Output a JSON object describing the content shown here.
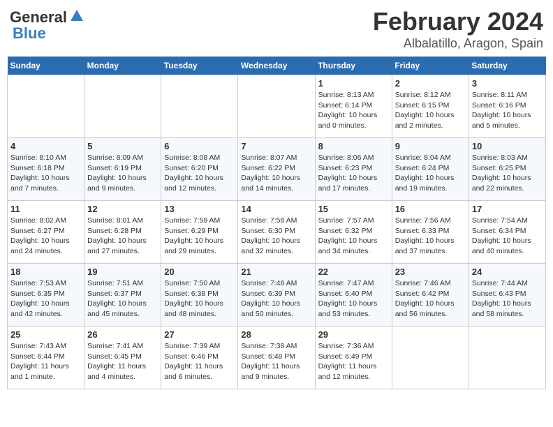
{
  "logo": {
    "text_general": "General",
    "text_blue": "Blue"
  },
  "header": {
    "title": "February 2024",
    "subtitle": "Albalatillo, Aragon, Spain"
  },
  "weekdays": [
    "Sunday",
    "Monday",
    "Tuesday",
    "Wednesday",
    "Thursday",
    "Friday",
    "Saturday"
  ],
  "weeks": [
    [
      {
        "day": "",
        "info": ""
      },
      {
        "day": "",
        "info": ""
      },
      {
        "day": "",
        "info": ""
      },
      {
        "day": "",
        "info": ""
      },
      {
        "day": "1",
        "info": "Sunrise: 8:13 AM\nSunset: 6:14 PM\nDaylight: 10 hours\nand 0 minutes."
      },
      {
        "day": "2",
        "info": "Sunrise: 8:12 AM\nSunset: 6:15 PM\nDaylight: 10 hours\nand 2 minutes."
      },
      {
        "day": "3",
        "info": "Sunrise: 8:11 AM\nSunset: 6:16 PM\nDaylight: 10 hours\nand 5 minutes."
      }
    ],
    [
      {
        "day": "4",
        "info": "Sunrise: 8:10 AM\nSunset: 6:18 PM\nDaylight: 10 hours\nand 7 minutes."
      },
      {
        "day": "5",
        "info": "Sunrise: 8:09 AM\nSunset: 6:19 PM\nDaylight: 10 hours\nand 9 minutes."
      },
      {
        "day": "6",
        "info": "Sunrise: 8:08 AM\nSunset: 6:20 PM\nDaylight: 10 hours\nand 12 minutes."
      },
      {
        "day": "7",
        "info": "Sunrise: 8:07 AM\nSunset: 6:22 PM\nDaylight: 10 hours\nand 14 minutes."
      },
      {
        "day": "8",
        "info": "Sunrise: 8:06 AM\nSunset: 6:23 PM\nDaylight: 10 hours\nand 17 minutes."
      },
      {
        "day": "9",
        "info": "Sunrise: 8:04 AM\nSunset: 6:24 PM\nDaylight: 10 hours\nand 19 minutes."
      },
      {
        "day": "10",
        "info": "Sunrise: 8:03 AM\nSunset: 6:25 PM\nDaylight: 10 hours\nand 22 minutes."
      }
    ],
    [
      {
        "day": "11",
        "info": "Sunrise: 8:02 AM\nSunset: 6:27 PM\nDaylight: 10 hours\nand 24 minutes."
      },
      {
        "day": "12",
        "info": "Sunrise: 8:01 AM\nSunset: 6:28 PM\nDaylight: 10 hours\nand 27 minutes."
      },
      {
        "day": "13",
        "info": "Sunrise: 7:59 AM\nSunset: 6:29 PM\nDaylight: 10 hours\nand 29 minutes."
      },
      {
        "day": "14",
        "info": "Sunrise: 7:58 AM\nSunset: 6:30 PM\nDaylight: 10 hours\nand 32 minutes."
      },
      {
        "day": "15",
        "info": "Sunrise: 7:57 AM\nSunset: 6:32 PM\nDaylight: 10 hours\nand 34 minutes."
      },
      {
        "day": "16",
        "info": "Sunrise: 7:56 AM\nSunset: 6:33 PM\nDaylight: 10 hours\nand 37 minutes."
      },
      {
        "day": "17",
        "info": "Sunrise: 7:54 AM\nSunset: 6:34 PM\nDaylight: 10 hours\nand 40 minutes."
      }
    ],
    [
      {
        "day": "18",
        "info": "Sunrise: 7:53 AM\nSunset: 6:35 PM\nDaylight: 10 hours\nand 42 minutes."
      },
      {
        "day": "19",
        "info": "Sunrise: 7:51 AM\nSunset: 6:37 PM\nDaylight: 10 hours\nand 45 minutes."
      },
      {
        "day": "20",
        "info": "Sunrise: 7:50 AM\nSunset: 6:38 PM\nDaylight: 10 hours\nand 48 minutes."
      },
      {
        "day": "21",
        "info": "Sunrise: 7:48 AM\nSunset: 6:39 PM\nDaylight: 10 hours\nand 50 minutes."
      },
      {
        "day": "22",
        "info": "Sunrise: 7:47 AM\nSunset: 6:40 PM\nDaylight: 10 hours\nand 53 minutes."
      },
      {
        "day": "23",
        "info": "Sunrise: 7:46 AM\nSunset: 6:42 PM\nDaylight: 10 hours\nand 56 minutes."
      },
      {
        "day": "24",
        "info": "Sunrise: 7:44 AM\nSunset: 6:43 PM\nDaylight: 10 hours\nand 58 minutes."
      }
    ],
    [
      {
        "day": "25",
        "info": "Sunrise: 7:43 AM\nSunset: 6:44 PM\nDaylight: 11 hours\nand 1 minute."
      },
      {
        "day": "26",
        "info": "Sunrise: 7:41 AM\nSunset: 6:45 PM\nDaylight: 11 hours\nand 4 minutes."
      },
      {
        "day": "27",
        "info": "Sunrise: 7:39 AM\nSunset: 6:46 PM\nDaylight: 11 hours\nand 6 minutes."
      },
      {
        "day": "28",
        "info": "Sunrise: 7:38 AM\nSunset: 6:48 PM\nDaylight: 11 hours\nand 9 minutes."
      },
      {
        "day": "29",
        "info": "Sunrise: 7:36 AM\nSunset: 6:49 PM\nDaylight: 11 hours\nand 12 minutes."
      },
      {
        "day": "",
        "info": ""
      },
      {
        "day": "",
        "info": ""
      }
    ]
  ]
}
